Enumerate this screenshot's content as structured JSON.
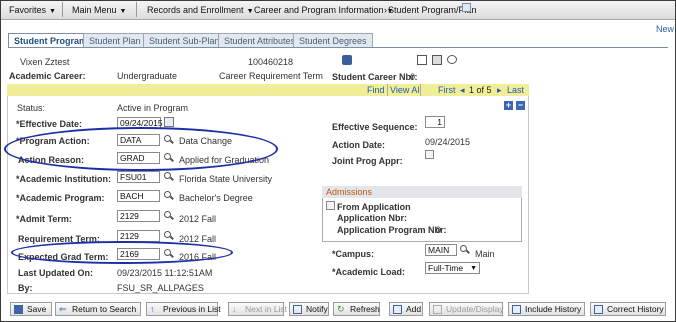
{
  "nav": {
    "favorites": "Favorites",
    "main_menu": "Main Menu",
    "records": "Records and Enrollment",
    "career": "Career and Program Information",
    "current": "Student Program/Plan",
    "new_window": "New"
  },
  "tabs": [
    "Student Program",
    "Student Plan",
    "Student Sub-Plan",
    "Student Attributes",
    "Student Degrees"
  ],
  "header": {
    "name": "Vixen Zztest",
    "id": "100460218",
    "career_label": "Academic Career:",
    "career_value": "Undergraduate",
    "career_req_term": "Career Requirement Term",
    "career_nbr_label": "Student Career Nbr:",
    "career_nbr_value": "0"
  },
  "grid": {
    "find": "Find",
    "view_all": "View All",
    "first": "First",
    "pos": "1 of 5",
    "last": "Last"
  },
  "form": {
    "status_label": "Status:",
    "status_value": "Active in Program",
    "eff_date_label": "*Effective Date:",
    "eff_date_value": "09/24/2015",
    "eff_seq_label": "Effective Sequence:",
    "eff_seq_value": "1",
    "prog_action_label": "*Program Action:",
    "prog_action_value": "DATA",
    "prog_action_desc": "Data Change",
    "action_date_label": "Action Date:",
    "action_date_value": "09/24/2015",
    "action_reason_label": "Action Reason:",
    "action_reason_value": "GRAD",
    "action_reason_desc": "Applied for Graduation",
    "joint_label": "Joint Prog Appr:",
    "inst_label": "*Academic Institution:",
    "inst_value": "FSU01",
    "inst_desc": "Florida State University",
    "program_label": "*Academic Program:",
    "program_value": "BACH",
    "program_desc": "Bachelor's Degree",
    "admit_label": "*Admit Term:",
    "admit_value": "2129",
    "admit_desc": "2012 Fall",
    "req_term_label": "Requirement Term:",
    "req_term_value": "2129",
    "req_term_desc": "2012 Fall",
    "grad_label": "Expected Grad Term:",
    "grad_value": "2169",
    "grad_desc": "2016 Fall",
    "updated_label": "Last Updated On:",
    "updated_value": "09/23/2015 11:12:51AM",
    "by_label": "By:",
    "by_value": "FSU_SR_ALLPAGES",
    "campus_label": "*Campus:",
    "campus_value": "MAIN",
    "campus_desc": "Main",
    "load_label": "*Academic Load:",
    "load_value": "Full-Time"
  },
  "admissions": {
    "title": "Admissions",
    "from_app": "From Application",
    "app_nbr": "Application Nbr:",
    "app_prog_nbr": "Application Program Nbr:",
    "app_prog_nbr_value": "0"
  },
  "buttons": {
    "save": "Save",
    "return": "Return to Search",
    "prev": "Previous in List",
    "next": "Next in List",
    "notify": "Notify",
    "refresh": "Refresh",
    "add": "Add",
    "update": "Update/Display",
    "include": "Include History",
    "correct": "Correct History"
  },
  "colors": {
    "ellipse": "#1c2fa8",
    "link": "#2159b4",
    "grid_bar": "#f0ef98"
  }
}
